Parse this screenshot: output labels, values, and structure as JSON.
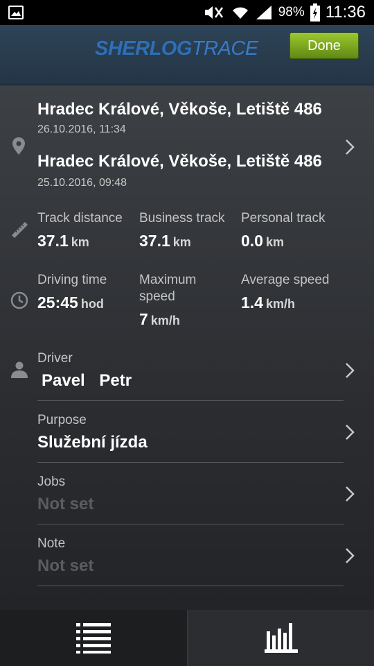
{
  "status_bar": {
    "battery_percent": "98%",
    "time": "11:36"
  },
  "header": {
    "logo_bold": "SHERLOG",
    "logo_light": "TRACE",
    "done_label": "Done"
  },
  "trip": {
    "start_address": "Hradec Králové, Věkoše, Letiště 486",
    "start_datetime": "26.10.2016, 11:34",
    "end_address": "Hradec Králové, Věkoše, Letiště 486",
    "end_datetime": "25.10.2016, 09:48"
  },
  "distance": {
    "track_label": "Track distance",
    "track_value": "37.1",
    "business_label": "Business track",
    "business_value": "37.1",
    "personal_label": "Personal track",
    "personal_value": "0.0",
    "unit": "km"
  },
  "time": {
    "driving_label": "Driving time",
    "driving_value": "25:45",
    "driving_unit": "hod",
    "max_speed_label_line1": "Maximum",
    "max_speed_label_line2": "speed",
    "max_speed_value": "7",
    "avg_speed_label": "Average speed",
    "avg_speed_value": "1.4",
    "speed_unit": "km/h"
  },
  "driver": {
    "label": "Driver",
    "first_name": "Pavel",
    "last_name": "Petr"
  },
  "purpose": {
    "label": "Purpose",
    "value": "Služební jízda"
  },
  "jobs": {
    "label": "Jobs",
    "value": "Not set"
  },
  "note": {
    "label": "Note",
    "value": "Not set"
  },
  "icons": {
    "gallery": "image-icon",
    "location": "map-pin-icon",
    "distance": "ruler-icon",
    "time": "clock-icon",
    "driver": "person-icon",
    "list_tab": "list-icon",
    "stats_tab": "bar-chart-icon"
  },
  "colors": {
    "done_button": "#7fae22",
    "logo": "#2f6fb5",
    "header_bg": "#2a3f52"
  }
}
